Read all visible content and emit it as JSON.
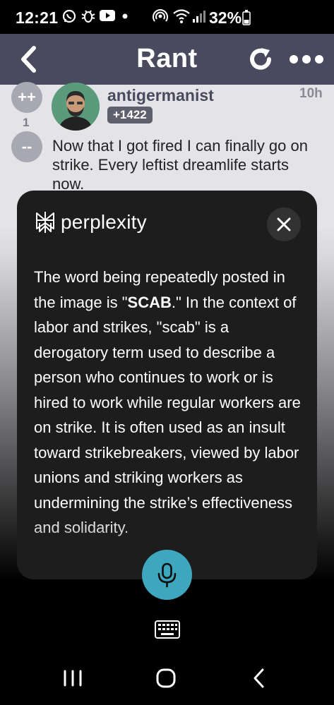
{
  "status_bar": {
    "time": "12:21",
    "battery": "32%",
    "icons": [
      "whatsapp-icon",
      "bug-icon",
      "youtube-icon",
      "dot-icon",
      "hotspot-icon",
      "wifi-icon",
      "signal-icon",
      "battery-icon"
    ]
  },
  "app_bar": {
    "title": "Rant",
    "icons": [
      "back-chevron-icon",
      "refresh-icon",
      "more-dots-icon"
    ]
  },
  "post": {
    "upvote_label": "++",
    "downvote_label": "--",
    "vote_count": "1",
    "username": "antigermanist",
    "score": "+1422",
    "time": "10h",
    "text": "Now that I got fired I can finally go on strike. Every leftist dreamlife starts now."
  },
  "card": {
    "brand": "perplexity",
    "answer_part1": "The word being repeatedly posted in the image is \"",
    "answer_bold": "SCAB",
    "answer_part2": ".\" In the context of labor and strikes, \"scab\" is a derogatory term used to describe a person who continues to work or is hired to work while regular workers are on strike. It is often used as an insult toward strikebreakers, viewed by labor unions and striking workers as undermining the strike’s effectiveness and solidarity."
  },
  "colors": {
    "app_bar": "#4a4a5e",
    "mic_button": "#3ea7bd",
    "card_bg": "#1d1d1d"
  }
}
